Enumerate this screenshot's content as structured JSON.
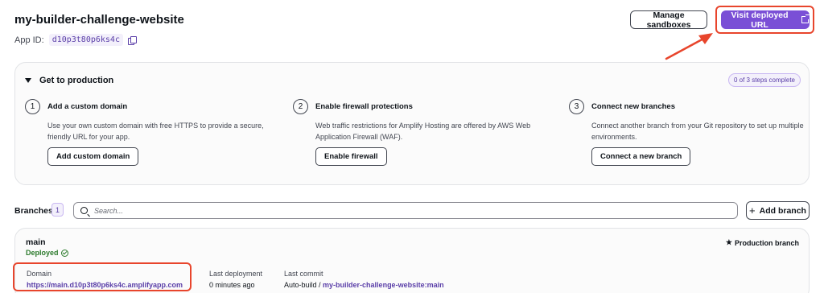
{
  "header": {
    "title": "my-builder-challenge-website",
    "app_id_label": "App ID:",
    "app_id": "d10p3t80p6ks4c",
    "manage_sandboxes": "Manage sandboxes",
    "visit_url": "Visit deployed URL"
  },
  "production": {
    "title": "Get to production",
    "badge": "0 of 3 steps complete",
    "steps": [
      {
        "num": "1",
        "title": "Add a custom domain",
        "desc": "Use your own custom domain with free HTTPS to provide a secure, friendly URL for your app.",
        "button": "Add custom domain"
      },
      {
        "num": "2",
        "title": "Enable firewall protections",
        "desc": "Web traffic restrictions for Amplify Hosting are offered by AWS Web Application Firewall (WAF).",
        "button": "Enable firewall"
      },
      {
        "num": "3",
        "title": "Connect new branches",
        "desc": "Connect another branch from your Git repository to set up multiple environments.",
        "button": "Connect a new branch"
      }
    ]
  },
  "branches": {
    "label": "Branches",
    "count": "1",
    "search_placeholder": "Search...",
    "add_branch": "Add branch"
  },
  "branch_card": {
    "name": "main",
    "status": "Deployed",
    "production_label": "Production branch",
    "domain_label": "Domain",
    "domain_value": "https://main.d10p3t80p6ks4c.amplifyapp.com",
    "last_deployment_label": "Last deployment",
    "last_deployment_value": "0 minutes ago",
    "last_commit_label": "Last commit",
    "last_commit_prefix": "Auto-build /",
    "last_commit_link": "my-builder-challenge-website:main"
  },
  "colors": {
    "accent": "#7a4fd6",
    "annotation": "#e8452c",
    "success": "#2b7a2b"
  }
}
